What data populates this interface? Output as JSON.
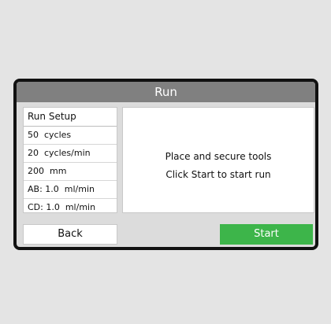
{
  "window": {
    "title": "Run"
  },
  "run_setup": {
    "header": "Run Setup",
    "rows": [
      "50  cycles",
      "20  cycles/min",
      "200  mm",
      "AB: 1.0  ml/min",
      "CD: 1.0  ml/min"
    ]
  },
  "message": {
    "line1": "Place and secure tools",
    "line2": "Click Start to start run"
  },
  "buttons": {
    "back_label": "Back",
    "start_label": "Start"
  },
  "colors": {
    "title_bar": "#808080",
    "start_button": "#3db54a",
    "frame": "#111111"
  }
}
